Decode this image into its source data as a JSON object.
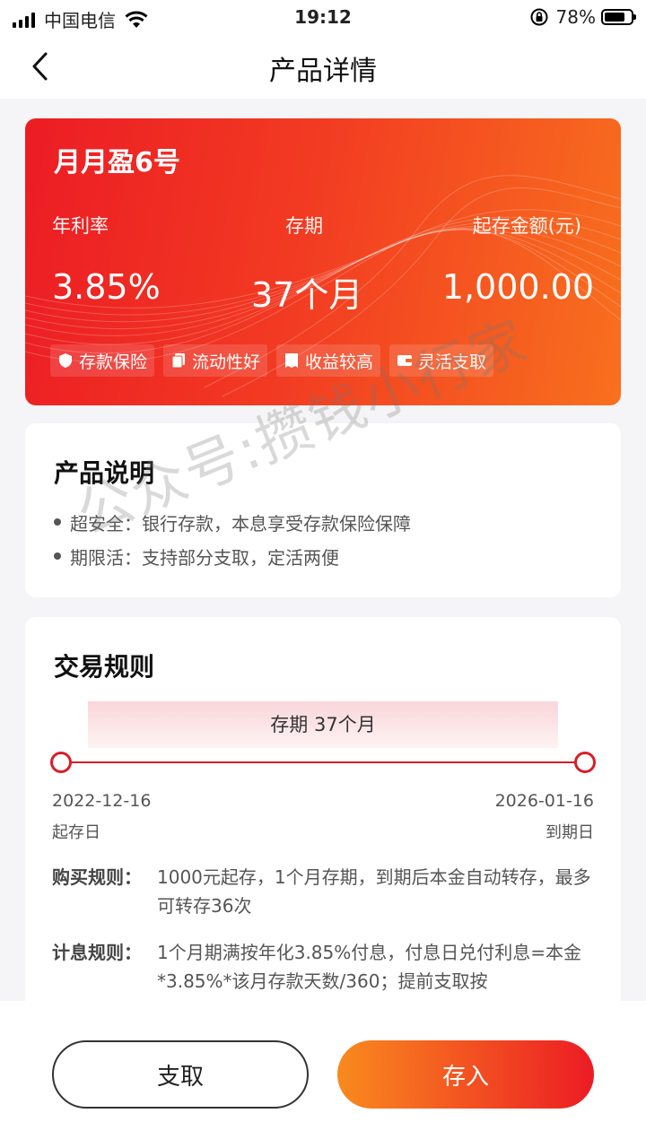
{
  "status_bar": {
    "carrier": "中国电信",
    "time": "19:12",
    "battery": "78%",
    "battery_level": 0.78
  },
  "nav": {
    "title": "产品详情"
  },
  "product": {
    "name": "月月盈6号",
    "rate_label": "年利率",
    "rate_value": "3.85%",
    "term_label": "存期",
    "term_value": "37个月",
    "min_label": "起存金额(元)",
    "min_value": "1,000.00",
    "tags": [
      "存款保险",
      "流动性好",
      "收益较高",
      "灵活支取"
    ]
  },
  "description": {
    "title": "产品说明",
    "items": [
      "超安全：银行存款，本息享受存款保险保障",
      "期限活：支持部分支取，定活两便"
    ]
  },
  "rules": {
    "title": "交易规则",
    "term_banner": "存期  37个月",
    "start_date": "2022-12-16",
    "start_label": "起存日",
    "end_date": "2026-01-16",
    "end_label": "到期日",
    "buy_label": "购买规则：",
    "buy_text": "1000元起存，1个月存期，到期后本金自动转存，最多可转存36次",
    "interest_label": "计息规则：",
    "interest_text": "1个月期满按年化3.85%付息，付息日兑付利息=本金*3.85%*该月存款天数/360；提前支取按"
  },
  "watermark": "公众号:攒钱小行家",
  "actions": {
    "withdraw": "支取",
    "deposit": "存入"
  }
}
